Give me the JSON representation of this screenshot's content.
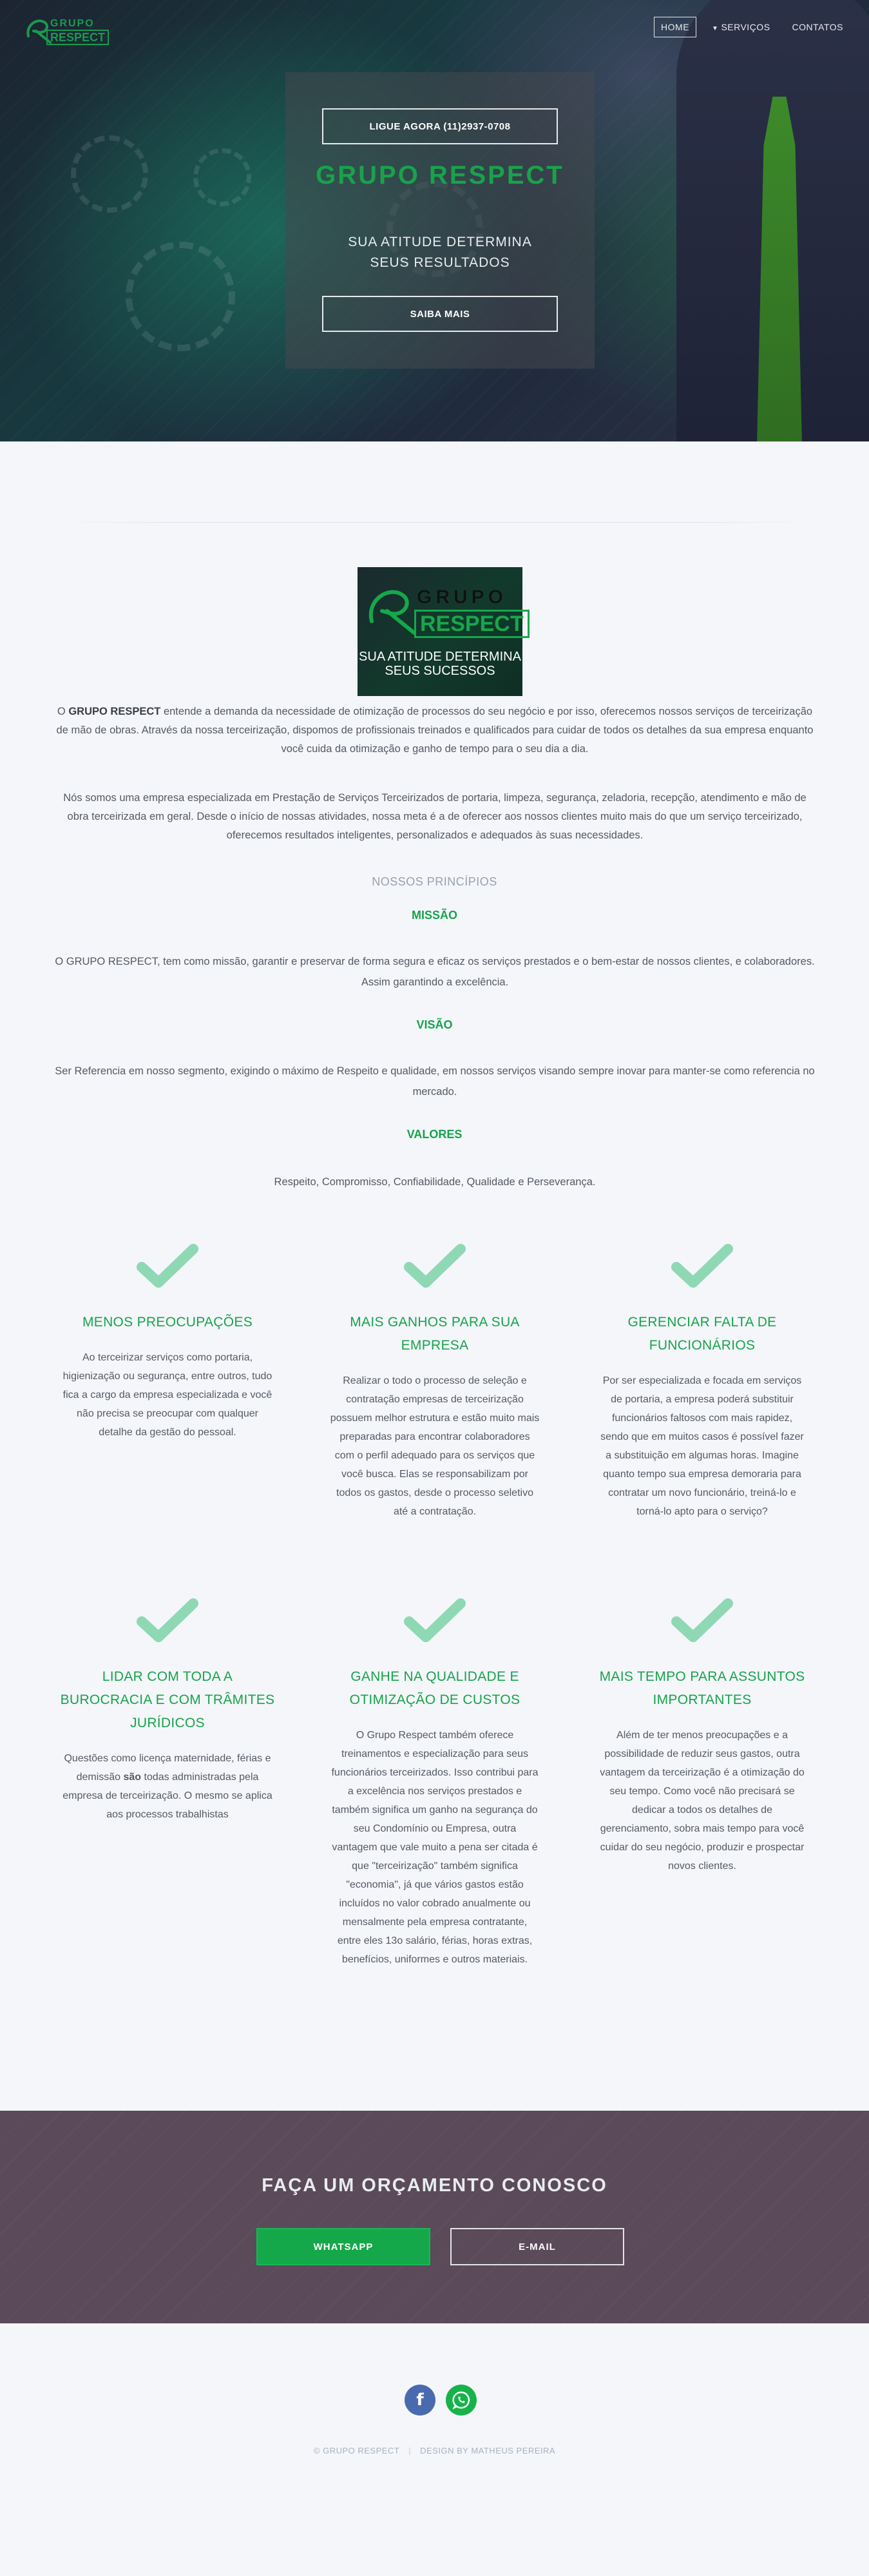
{
  "nav": {
    "items": [
      {
        "label": "HOME",
        "active": true
      },
      {
        "label": "SERVIÇOS",
        "active": false,
        "icon": "chevron-down-icon"
      },
      {
        "label": "CONTATOS",
        "active": false
      }
    ],
    "logo": {
      "top": "GRUPO",
      "bottom": "RESPECT"
    }
  },
  "hero": {
    "call_button": "LIGUE AGORA (11)2937-0708",
    "title": "GRUPO RESPECT",
    "subtitle_line1": "SUA ATITUDE DETERMINA",
    "subtitle_line2": "SEUS RESULTADOS",
    "more_button": "SAIBA MAIS"
  },
  "about": {
    "logo": {
      "top": "GRUPO",
      "bottom": "RESPECT",
      "slogan_line1": "SUA ATITUDE DETERMINA",
      "slogan_line2": "SEUS SUCESSOS"
    },
    "p1_lead": "O ",
    "p1_bold": "GRUPO RESPECT",
    "p1_text": " entende a demanda da necessidade de otimização de processos do seu negócio e por isso, oferecemos nossos serviços de terceirização de mão de obras. Através da nossa terceirização, dispomos de profissionais treinados e qualificados para cuidar de todos os detalhes da sua empresa enquanto você cuida da otimização e ganho de tempo para o seu dia a dia.",
    "p2": "Nós somos uma empresa especializada em Prestação de Serviços Terceirizados de portaria, limpeza, segurança, zeladoria, recepção, atendimento e mão de obra terceirizada em geral. Desde o início de nossas atividades, nossa meta é a de oferecer aos nossos clientes muito mais do que um serviço terceirizado, oferecemos resultados inteligentes, personalizados e adequados às suas necessidades.",
    "principles_label": "NOSSOS PRINCÍPIOS",
    "missao_title": "MISSÃO",
    "missao_text": "O GRUPO RESPECT, tem como missão, garantir e preservar de forma segura e eficaz os serviços prestados e o bem-estar de nossos clientes, e colaboradores. Assim garantindo a excelência.",
    "visao_title": "VISÃO",
    "visao_text": "Ser Referencia em nosso segmento, exigindo o máximo de Respeito e qualidade, em nossos serviços visando sempre inovar para manter-se como referencia no mercado.",
    "valores_title": "VALORES",
    "valores_text": "Respeito, Compromisso, Confiabilidade, Qualidade e Perseverança."
  },
  "benefits": [
    {
      "icon": "checkmark-icon",
      "title": "MENOS PREOCUPAÇÕES",
      "text": "Ao terceirizar serviços como portaria, higienização ou segurança, entre outros, tudo fica a cargo da empresa especializada e você não precisa se preocupar com qualquer detalhe da gestão do pessoal."
    },
    {
      "icon": "checkmark-icon",
      "title": "MAIS GANHOS PARA SUA EMPRESA",
      "text": "Realizar o todo o processo de seleção e contratação empresas de terceirização possuem melhor estrutura e estão muito mais preparadas para encontrar colaboradores com o perfil adequado para os serviços que você busca. Elas se responsabilizam por todos os gastos, desde o processo seletivo até a contratação."
    },
    {
      "icon": "checkmark-icon",
      "title": "GERENCIAR FALTA DE FUNCIONÁRIOS",
      "text": "Por ser especializada e focada em serviços de portaria, a empresa poderá substituir funcionários faltosos com mais rapidez, sendo que em muitos casos é possível fazer a substituição em algumas horas. Imagine quanto tempo sua empresa demoraria para contratar um novo funcionário, treiná-lo e torná-lo apto para o serviço?"
    },
    {
      "icon": "checkmark-icon",
      "title": "LIDAR COM TODA A BUROCRACIA E COM TRÂMITES JURÍDICOS",
      "text_a": "Questões como licença maternidade, férias e demissão ",
      "text_b": "são",
      "text_c": " todas administradas pela empresa de terceirização. O mesmo se aplica aos processos trabalhistas"
    },
    {
      "icon": "checkmark-icon",
      "title": "GANHE NA QUALIDADE E OTIMIZAÇÃO DE CUSTOS",
      "text": "O Grupo Respect também oferece treinamentos e especialização para seus funcionários terceirizados. Isso contribui para a excelência nos serviços prestados e também significa um ganho na segurança do seu Condomínio ou Empresa, outra vantagem que vale muito a pena ser citada é que \"terceirização\" também significa \"economia\", já que vários gastos estão incluídos no valor cobrado anualmente ou mensalmente pela empresa contratante, entre eles 13o salário, férias, horas extras, benefícios, uniformes e outros materiais."
    },
    {
      "icon": "checkmark-icon",
      "title": "MAIS TEMPO PARA ASSUNTOS IMPORTANTES",
      "text": "Além de ter menos preocupações e a possibilidade de reduzir seus gastos, outra vantagem da terceirização é a otimização do seu tempo. Como você não precisará se dedicar a todos os detalhes de gerenciamento, sobra mais tempo para você cuidar do seu negócio, produzir e prospectar novos clientes."
    }
  ],
  "cta": {
    "title": "FAÇA UM ORÇAMENTO CONOSCO",
    "whatsapp_button": "WHATSAPP",
    "email_button": "E-MAIL"
  },
  "footer": {
    "facebook_glyph": "f",
    "copyright": "© GRUPO RESPECT",
    "separator": "|",
    "credit": "DESIGN BY MATHEUS PEREIRA"
  },
  "colors": {
    "accent": "#17a34a",
    "cta_bg": "#5b4a5a",
    "facebook": "#4a6ab0",
    "whatsapp": "#17b34a",
    "check": "#8fd8b4"
  }
}
